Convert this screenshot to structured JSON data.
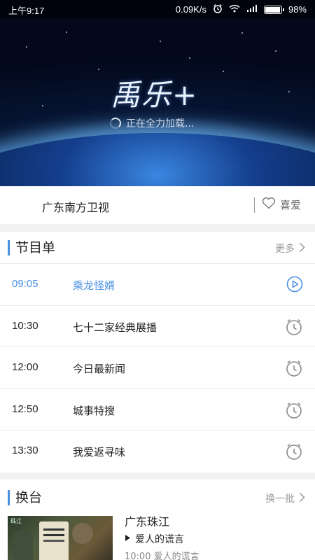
{
  "status_bar": {
    "time": "上午9:17",
    "network_speed": "0.09K/s",
    "battery": "98%",
    "battery_level": 0.98,
    "icons": [
      "alarm-icon",
      "wifi-icon",
      "signal-icon",
      "battery-icon"
    ]
  },
  "player": {
    "logo": "禹乐+",
    "loading_text": "正在全力加载..."
  },
  "channel_bar": {
    "channel_name": "广东南方卫视",
    "favorite_label": "喜爱"
  },
  "schedule": {
    "title": "节目单",
    "more_label": "更多",
    "programs": [
      {
        "time": "09:05",
        "title": "乘龙怪婿",
        "status": "playing",
        "icon": "play-circle-icon"
      },
      {
        "time": "10:30",
        "title": "七十二家经典展播",
        "status": "upcoming",
        "icon": "alarm-clock-icon"
      },
      {
        "time": "12:00",
        "title": "今日最新闻",
        "status": "upcoming",
        "icon": "alarm-clock-icon"
      },
      {
        "time": "12:50",
        "title": "城事特搜",
        "status": "upcoming",
        "icon": "alarm-clock-icon"
      },
      {
        "time": "13:30",
        "title": "我爱返寻味",
        "status": "upcoming",
        "icon": "alarm-clock-icon"
      }
    ]
  },
  "switch_channel": {
    "title": "换台",
    "refresh_label": "换一批",
    "cards": [
      {
        "channel": "广东珠江",
        "now_playing": "爱人的谎言",
        "next": "10:00  爱人的谎言"
      }
    ]
  },
  "colors": {
    "accent": "#4a90e2",
    "text": "#222222",
    "muted": "#999999"
  }
}
